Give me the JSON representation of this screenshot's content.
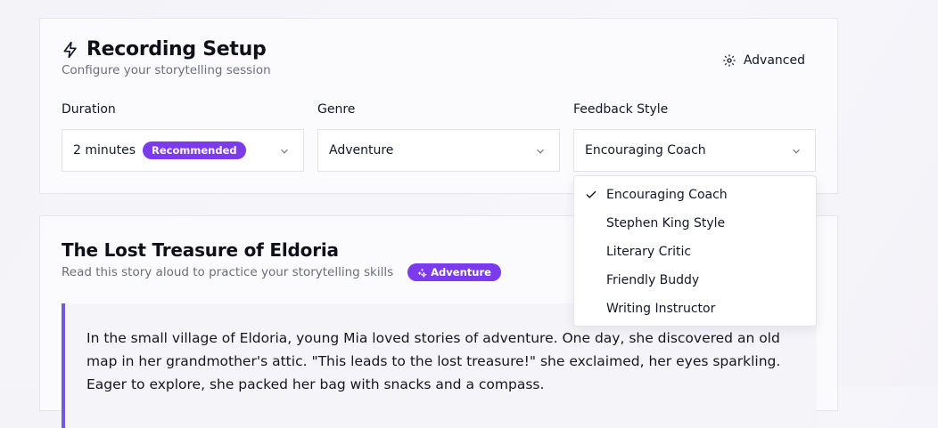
{
  "setup": {
    "title": "Recording Setup",
    "subtitle": "Configure your storytelling session",
    "advanced_label": "Advanced",
    "fields": {
      "duration": {
        "label": "Duration",
        "value": "2 minutes",
        "badge": "Recommended"
      },
      "genre": {
        "label": "Genre",
        "value": "Adventure"
      },
      "feedback": {
        "label": "Feedback Style",
        "value": "Encouraging Coach"
      }
    },
    "feedback_options": [
      {
        "label": "Encouraging Coach",
        "selected": true
      },
      {
        "label": "Stephen King Style",
        "selected": false
      },
      {
        "label": "Literary Critic",
        "selected": false
      },
      {
        "label": "Friendly Buddy",
        "selected": false
      },
      {
        "label": "Writing Instructor",
        "selected": false
      }
    ]
  },
  "story": {
    "title": "The Lost Treasure of Eldoria",
    "subtitle": "Read this story aloud to practice your storytelling skills",
    "genre_badge": "Adventure",
    "text": "In the small village of Eldoria, young Mia loved stories of adventure. One day, she discovered an old map in her grandmother's attic. \"This leads to the lost treasure!\" she exclaimed, her eyes sparkling. Eager to explore, she packed her bag with snacks and a compass."
  },
  "colors": {
    "accent": "#7c3aed",
    "quote_bar": "#6d5ae0"
  },
  "icons": {
    "title": "lightning-icon",
    "advanced": "gear-icon",
    "select": "chevron-down-icon",
    "check": "check-icon",
    "badge": "sparkles-icon"
  }
}
